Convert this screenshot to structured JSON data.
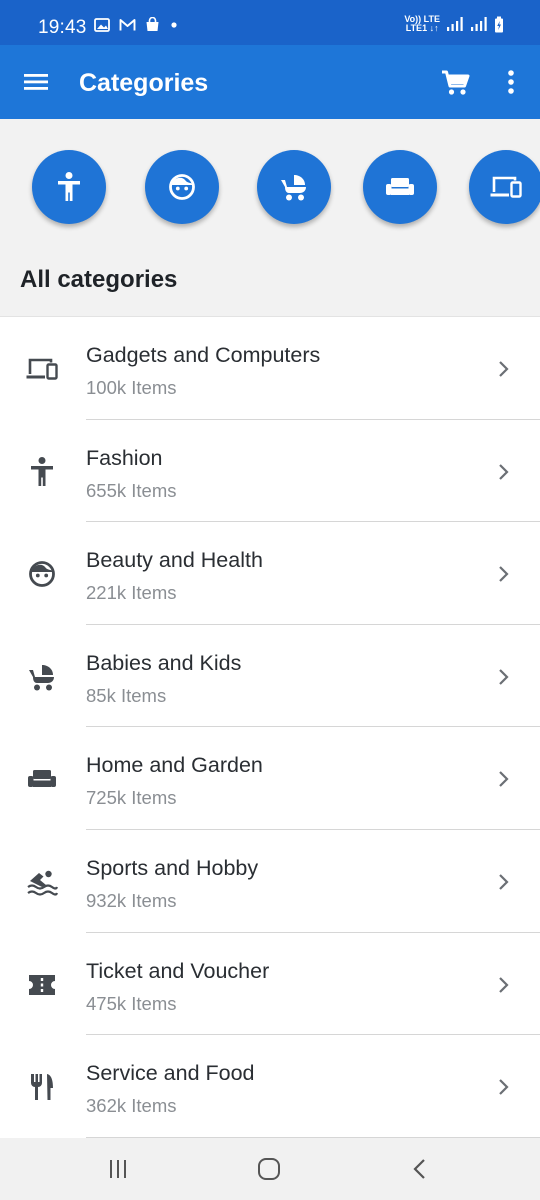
{
  "status_bar": {
    "time": "19:43",
    "network_top": "Vo)) LTE",
    "network_bottom": "LTE1 ↓↑"
  },
  "app_bar": {
    "title": "Categories",
    "icons": [
      "menu-icon",
      "cart-icon",
      "more-vert-icon"
    ]
  },
  "quick_categories": [
    {
      "icon": "person-icon"
    },
    {
      "icon": "face-icon"
    },
    {
      "icon": "stroller-icon"
    },
    {
      "icon": "sofa-icon"
    },
    {
      "icon": "devices-icon"
    }
  ],
  "section_title": "All categories",
  "categories": [
    {
      "name": "Gadgets and Computers",
      "count": "100k Items",
      "icon": "devices-icon"
    },
    {
      "name": "Fashion",
      "count": "655k Items",
      "icon": "person-icon"
    },
    {
      "name": "Beauty and Health",
      "count": "221k Items",
      "icon": "face-icon"
    },
    {
      "name": "Babies and Kids",
      "count": "85k Items",
      "icon": "stroller-icon"
    },
    {
      "name": "Home and Garden",
      "count": "725k Items",
      "icon": "sofa-icon"
    },
    {
      "name": "Sports and Hobby",
      "count": "932k Items",
      "icon": "swimmer-icon"
    },
    {
      "name": "Ticket and Voucher",
      "count": "475k Items",
      "icon": "ticket-icon"
    },
    {
      "name": "Service and Food",
      "count": "362k Items",
      "icon": "restaurant-icon"
    }
  ],
  "colors": {
    "status_bar": "#1a63c9",
    "app_bar": "#1e76d8",
    "accent": "#1f74d6",
    "icon_gray": "#454a50"
  }
}
